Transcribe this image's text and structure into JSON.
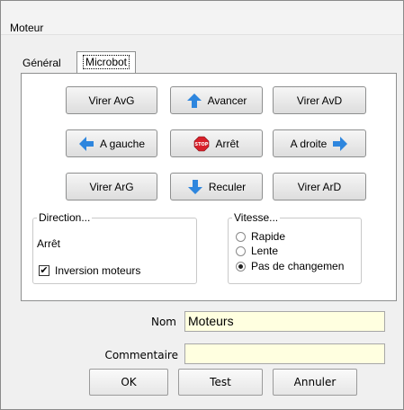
{
  "window": {
    "title": "Moteur"
  },
  "tabs": [
    {
      "label": "Général",
      "active": false
    },
    {
      "label": "Microbot",
      "active": true
    }
  ],
  "motion_buttons": {
    "virer_avg": "Virer AvG",
    "avancer": "Avancer",
    "virer_avd": "Virer AvD",
    "a_gauche": "A gauche",
    "arret": "Arrêt",
    "a_droite": "A droite",
    "virer_arg": "Virer ArG",
    "reculer": "Reculer",
    "virer_ard": "Virer ArD"
  },
  "direction": {
    "legend": "Direction...",
    "state": "Arrêt",
    "inversion_label": "Inversion moteurs",
    "inversion_checked": true
  },
  "vitesse": {
    "legend": "Vitesse...",
    "options": [
      "Rapide",
      "Lente",
      "Pas de changemen"
    ],
    "selected": "Pas de changemen"
  },
  "form": {
    "nom_label": "Nom",
    "nom_value": "Moteurs",
    "commentaire_label": "Commentaire",
    "commentaire_value": ""
  },
  "footer": {
    "ok": "OK",
    "test": "Test",
    "cancel": "Annuler"
  },
  "colors": {
    "field_bg": "#ffffe0",
    "arrow_blue": "#2e86de",
    "stop_red": "#d8202a"
  }
}
